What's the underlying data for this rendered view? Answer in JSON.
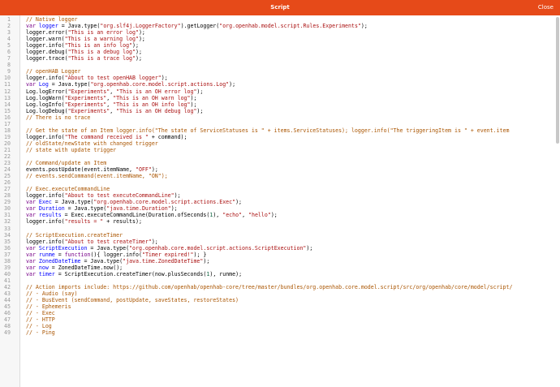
{
  "header": {
    "title": "Script",
    "close_label": "Close"
  },
  "editor": {
    "lines": [
      [
        [
          "com",
          "// Native logger"
        ]
      ],
      [
        [
          "kw",
          "var"
        ],
        [
          "txt",
          " "
        ],
        [
          "var",
          "logger"
        ],
        [
          "txt",
          " = Java.type("
        ],
        [
          "str",
          "\"org.slf4j.LoggerFactory\""
        ],
        [
          "txt",
          ").getLogger("
        ],
        [
          "str",
          "\"org.openhab.model.script.Rules.Experiments\""
        ],
        [
          "txt",
          ");"
        ]
      ],
      [
        [
          "txt",
          "logger.error("
        ],
        [
          "str",
          "\"This is an error log\""
        ],
        [
          "txt",
          ");"
        ]
      ],
      [
        [
          "txt",
          "logger.warn("
        ],
        [
          "str",
          "\"This is a warning log\""
        ],
        [
          "txt",
          ");"
        ]
      ],
      [
        [
          "txt",
          "logger.info("
        ],
        [
          "str",
          "\"This is an info log\""
        ],
        [
          "txt",
          ");"
        ]
      ],
      [
        [
          "txt",
          "logger.debug("
        ],
        [
          "str",
          "\"This is a debug log\""
        ],
        [
          "txt",
          ");"
        ]
      ],
      [
        [
          "txt",
          "logger.trace("
        ],
        [
          "str",
          "\"This is a trace log\""
        ],
        [
          "txt",
          ");"
        ]
      ],
      [],
      [
        [
          "com",
          "// openHAB Logger"
        ]
      ],
      [
        [
          "txt",
          "logger.info("
        ],
        [
          "str",
          "\"About to test openHAB logger\""
        ],
        [
          "txt",
          ");"
        ]
      ],
      [
        [
          "kw",
          "var"
        ],
        [
          "txt",
          " "
        ],
        [
          "var",
          "Log"
        ],
        [
          "txt",
          " = Java.type("
        ],
        [
          "str",
          "\"org.openhab.core.model.script.actions.Log\""
        ],
        [
          "txt",
          ");"
        ]
      ],
      [
        [
          "txt",
          "Log.logError("
        ],
        [
          "str",
          "\"Experiments\""
        ],
        [
          "txt",
          ", "
        ],
        [
          "str",
          "\"This is an OH error log\""
        ],
        [
          "txt",
          ");"
        ]
      ],
      [
        [
          "txt",
          "Log.logWarn("
        ],
        [
          "str",
          "\"Experiments\""
        ],
        [
          "txt",
          ", "
        ],
        [
          "str",
          "\"This is an OH warn log\""
        ],
        [
          "txt",
          ");"
        ]
      ],
      [
        [
          "txt",
          "Log.logInfo("
        ],
        [
          "str",
          "\"Experiments\""
        ],
        [
          "txt",
          ", "
        ],
        [
          "str",
          "\"This is an OH info log\""
        ],
        [
          "txt",
          ");"
        ]
      ],
      [
        [
          "txt",
          "Log.logDebug("
        ],
        [
          "str",
          "\"Experiments\""
        ],
        [
          "txt",
          ", "
        ],
        [
          "str",
          "\"This is an OH debug log\""
        ],
        [
          "txt",
          ");"
        ]
      ],
      [
        [
          "com",
          "// There is no trace"
        ]
      ],
      [],
      [
        [
          "com",
          "// Get the state of an Item logger.info(\"The state of ServiceStatuses is \" + items.ServiceStatuses); logger.info(\"The triggeringItem is \" + event.item"
        ]
      ],
      [
        [
          "txt",
          "logger.info("
        ],
        [
          "str",
          "\"The command received is \""
        ],
        [
          "txt",
          " + command);"
        ]
      ],
      [
        [
          "com",
          "// oldState/newState with changed trigger"
        ]
      ],
      [
        [
          "com",
          "// state with update trigger"
        ]
      ],
      [],
      [
        [
          "com",
          "// Command/update an Item"
        ]
      ],
      [
        [
          "txt",
          "events.postUpdate(event.itemName, "
        ],
        [
          "str",
          "\"OFF\""
        ],
        [
          "txt",
          ");"
        ]
      ],
      [
        [
          "com",
          "// events.sendCommand(event.itemName, \"ON\");"
        ]
      ],
      [],
      [
        [
          "com",
          "// Exec.executeCommandLine"
        ]
      ],
      [
        [
          "txt",
          "logger.info("
        ],
        [
          "str",
          "\"About to test executeCommandLine\""
        ],
        [
          "txt",
          ");"
        ]
      ],
      [
        [
          "kw",
          "var"
        ],
        [
          "txt",
          " "
        ],
        [
          "var",
          "Exec"
        ],
        [
          "txt",
          " = Java.type("
        ],
        [
          "str",
          "\"org.openhab.core.model.script.actions.Exec\""
        ],
        [
          "txt",
          ");"
        ]
      ],
      [
        [
          "kw",
          "var"
        ],
        [
          "txt",
          " "
        ],
        [
          "var",
          "Duration"
        ],
        [
          "txt",
          " = Java.type("
        ],
        [
          "str",
          "\"java.time.Duration\""
        ],
        [
          "txt",
          ");"
        ]
      ],
      [
        [
          "kw",
          "var"
        ],
        [
          "txt",
          " "
        ],
        [
          "var",
          "results"
        ],
        [
          "txt",
          " = Exec.executeCommandLine(Duration.ofSeconds("
        ],
        [
          "num",
          "1"
        ],
        [
          "txt",
          "), "
        ],
        [
          "str",
          "\"echo\""
        ],
        [
          "txt",
          ", "
        ],
        [
          "str",
          "\"hello\""
        ],
        [
          "txt",
          ");"
        ]
      ],
      [
        [
          "txt",
          "logger.info("
        ],
        [
          "str",
          "\"results = \""
        ],
        [
          "txt",
          " + results);"
        ]
      ],
      [],
      [
        [
          "com",
          "// ScriptExecution.createTimer"
        ]
      ],
      [
        [
          "txt",
          "logger.info("
        ],
        [
          "str",
          "\"About to test createTimer\""
        ],
        [
          "txt",
          ");"
        ]
      ],
      [
        [
          "kw",
          "var"
        ],
        [
          "txt",
          " "
        ],
        [
          "var",
          "ScriptExecution"
        ],
        [
          "txt",
          " = Java.type("
        ],
        [
          "str",
          "\"org.openhab.core.model.script.actions.ScriptExecution\""
        ],
        [
          "txt",
          ");"
        ]
      ],
      [
        [
          "kw",
          "var"
        ],
        [
          "txt",
          " "
        ],
        [
          "var",
          "runme"
        ],
        [
          "txt",
          " = "
        ],
        [
          "kw",
          "function"
        ],
        [
          "txt",
          "(){ logger.info("
        ],
        [
          "str",
          "\"Timer expired!\""
        ],
        [
          "txt",
          "); }"
        ]
      ],
      [
        [
          "kw",
          "var"
        ],
        [
          "txt",
          " "
        ],
        [
          "var",
          "ZonedDateTime"
        ],
        [
          "txt",
          " = Java.type("
        ],
        [
          "str",
          "\"java.time.ZonedDateTime\""
        ],
        [
          "txt",
          ");"
        ]
      ],
      [
        [
          "kw",
          "var"
        ],
        [
          "txt",
          " "
        ],
        [
          "var",
          "now"
        ],
        [
          "txt",
          " = ZonedDateTime.now();"
        ]
      ],
      [
        [
          "kw",
          "var"
        ],
        [
          "txt",
          " "
        ],
        [
          "var",
          "timer"
        ],
        [
          "txt",
          " = ScriptExecution.createTimer(now.plusSeconds("
        ],
        [
          "num",
          "1"
        ],
        [
          "txt",
          "), runme);"
        ]
      ],
      [],
      [
        [
          "com",
          "// Action imports include: https://github.com/openhab/openhab-core/tree/master/bundles/org.openhab.core.model.script/src/org/openhab/core/model/script/"
        ]
      ],
      [
        [
          "com",
          "// - Audio (say)"
        ]
      ],
      [
        [
          "com",
          "// - BusEvent (sendCommand, postUpdate, saveStates, restoreStates)"
        ]
      ],
      [
        [
          "com",
          "// - Ephemeris"
        ]
      ],
      [
        [
          "com",
          "// - Exec"
        ]
      ],
      [
        [
          "com",
          "// - HTTP"
        ]
      ],
      [
        [
          "com",
          "// - Log"
        ]
      ],
      [
        [
          "com",
          "// - Ping"
        ]
      ]
    ]
  }
}
